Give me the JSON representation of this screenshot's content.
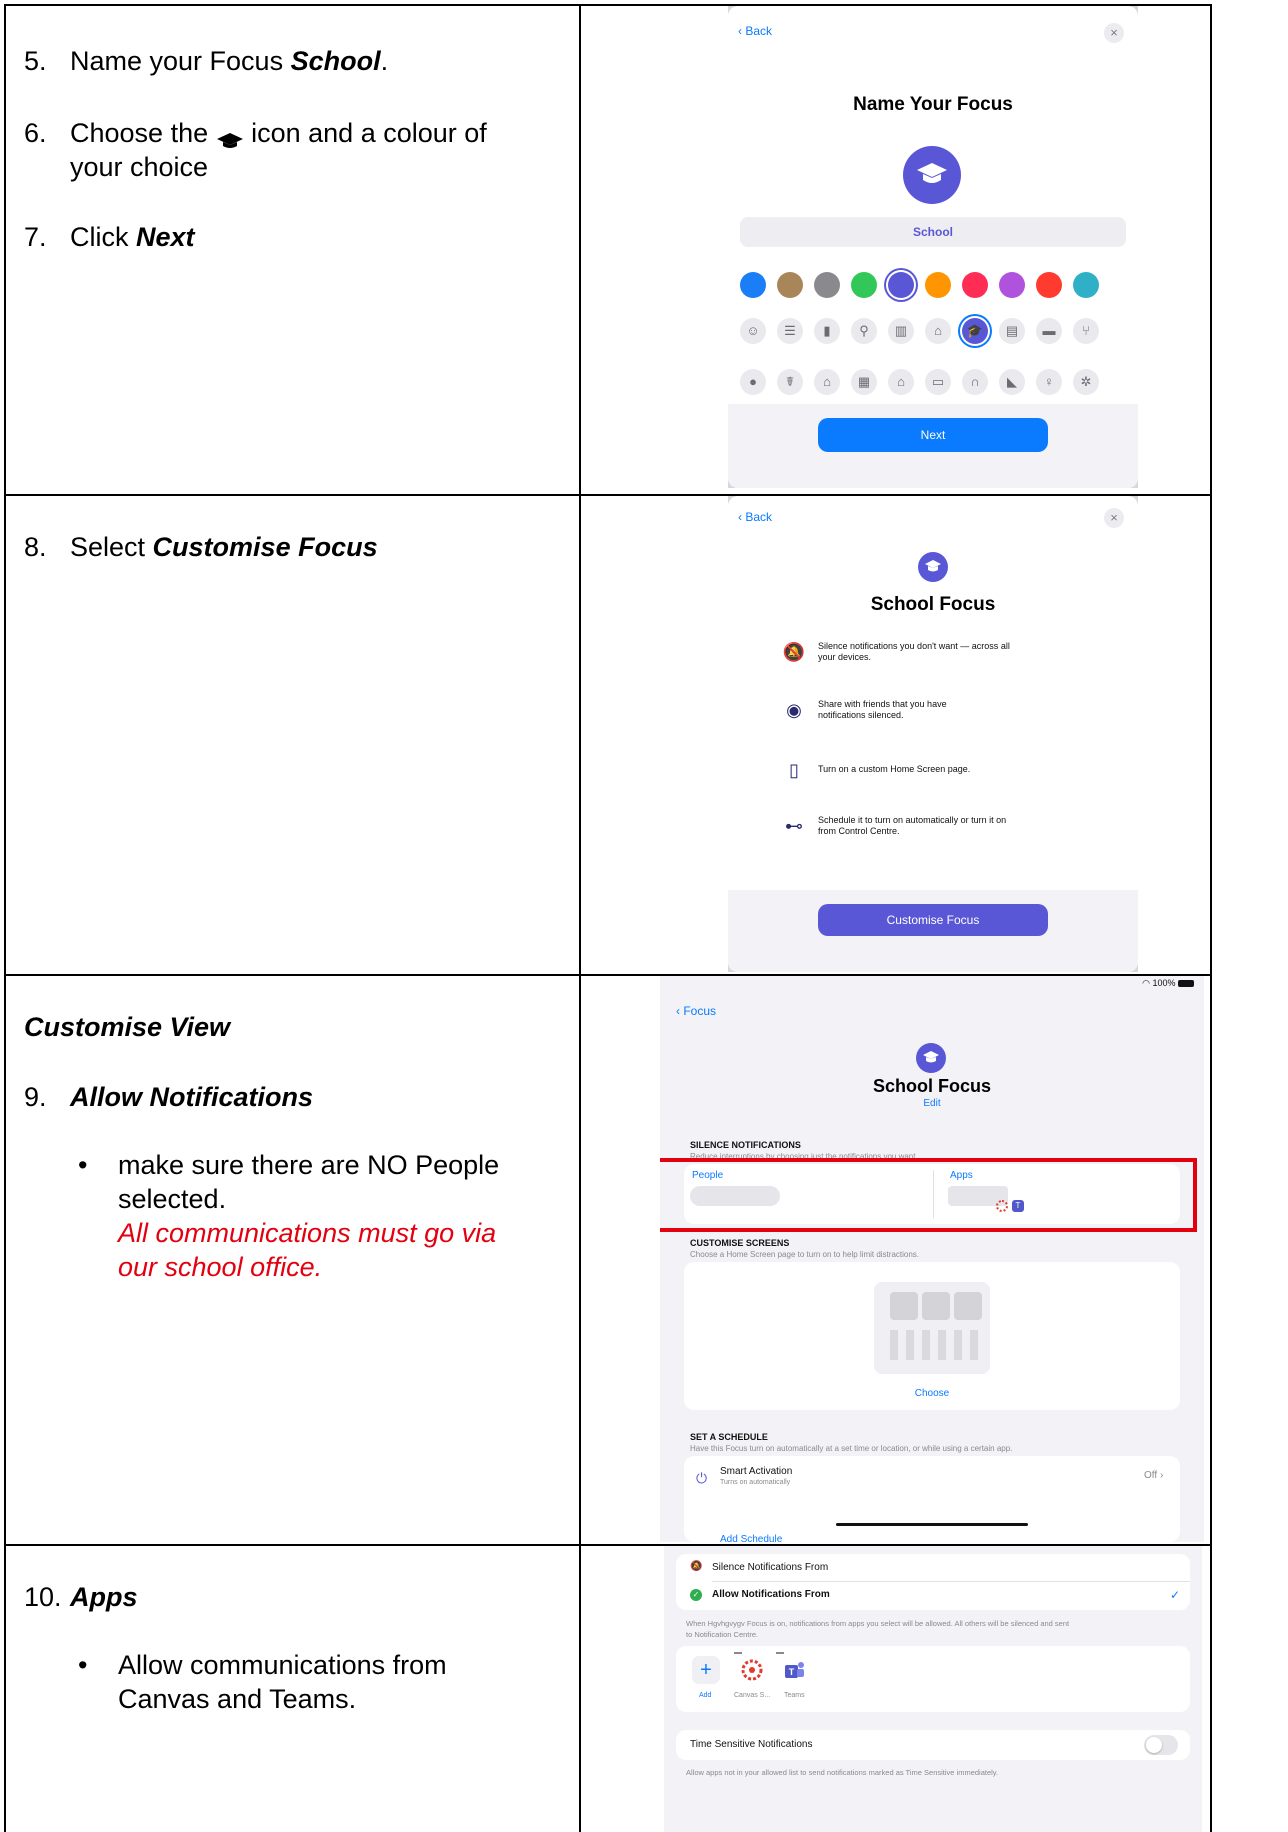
{
  "rows": {
    "r1": {
      "steps": [
        {
          "num": "5.",
          "pre": "Name your Focus ",
          "em": "School",
          "post": "."
        },
        {
          "num": "6.",
          "pre": "Choose the ",
          "post_line1": " icon and a colour of",
          "line2": "your choice",
          "icon": "graduation-cap-icon"
        },
        {
          "num": "7.",
          "pre": "Click ",
          "em": "Next"
        }
      ],
      "shot": {
        "back_label": "Back",
        "close_glyph": "×",
        "title": "Name Your Focus",
        "name_value": "School",
        "button_label": "Next",
        "swatches": [
          "#1a7ef6",
          "#a8865a",
          "#8a8a8e",
          "#32c759",
          "#5957d6",
          "#ff9500",
          "#ff2d55",
          "#af52de",
          "#ff3b30",
          "#30b0c7"
        ],
        "selected_color": "#5957d6",
        "glyph_row1": [
          "☺",
          "☰",
          "▮",
          "⚲",
          "▥",
          "⌂",
          "🎓",
          "▤",
          "▬",
          "⑂"
        ],
        "glyph_row2": [
          "●",
          "☤",
          "⌂",
          "▦",
          "⌂",
          "▭",
          "∩",
          "◣",
          "♀",
          "✲"
        ]
      }
    },
    "r2": {
      "step": {
        "num": "8.",
        "pre": "Select ",
        "em": "Customise Focus"
      },
      "shot": {
        "back_label": "Back",
        "close_glyph": "×",
        "title": "School Focus",
        "features": [
          {
            "icon": "bell-slash-icon",
            "glyph": "🔕",
            "line1": "Silence notifications you don't want — across all",
            "line2": "your devices."
          },
          {
            "icon": "share-person-icon",
            "glyph": "◉",
            "line1": "Share with friends that you have",
            "line2": "notifications silenced."
          },
          {
            "icon": "home-screen-icon",
            "glyph": "▯",
            "line1": "Turn on a custom Home Screen page.",
            "line2": ""
          },
          {
            "icon": "toggle-icon",
            "glyph": "⊷",
            "line1": "Schedule it to turn on automatically or turn it on",
            "line2": "from Control Centre."
          }
        ],
        "button_label": "Customise Focus"
      }
    },
    "r3": {
      "heading": "Customise View",
      "step": {
        "num": "9.",
        "em": "Allow Notifications"
      },
      "bullet_line1": "make sure there are NO People",
      "bullet_line2": "selected.",
      "red_line1": "All communications must go via",
      "red_line2": "our school office.",
      "shot": {
        "status": "100%",
        "back_label": "Focus",
        "title": "School Focus",
        "edit_label": "Edit",
        "silence_heading": "SILENCE NOTIFICATIONS",
        "silence_sub": "Reduce interruptions by choosing just the notifications you want.",
        "people_label": "People",
        "apps_label": "Apps",
        "screens_heading": "CUSTOMISE SCREENS",
        "screens_sub": "Choose a Home Screen page to turn on to help limit distractions.",
        "choose_label": "Choose",
        "schedule_heading": "SET A SCHEDULE",
        "schedule_sub": "Have this Focus turn on automatically at a set time or location, or while using a certain app.",
        "smart_title": "Smart Activation",
        "smart_sub": "Turns on automatically",
        "smart_value": "Off",
        "add_schedule": "Add Schedule"
      }
    },
    "r4": {
      "step": {
        "num": "10.",
        "em": "Apps"
      },
      "bullet_line1": "Allow communications from",
      "bullet_line2": "Canvas and Teams.",
      "shot": {
        "silence_from": "Silence Notifications From",
        "allow_from": "Allow Notifications From",
        "desc_line1": "When Hgvhgvygv Focus is on, notifications from apps you select will be allowed. All others will be silenced and sent",
        "desc_line2": "to Notification Centre.",
        "add_label": "Add",
        "canvas_label": "Canvas S...",
        "teams_label": "Teams",
        "time_sensitive": "Time Sensitive Notifications",
        "time_sensitive_sub": "Allow apps not in your allowed list to send notifications marked as Time Sensitive immediately."
      }
    }
  }
}
